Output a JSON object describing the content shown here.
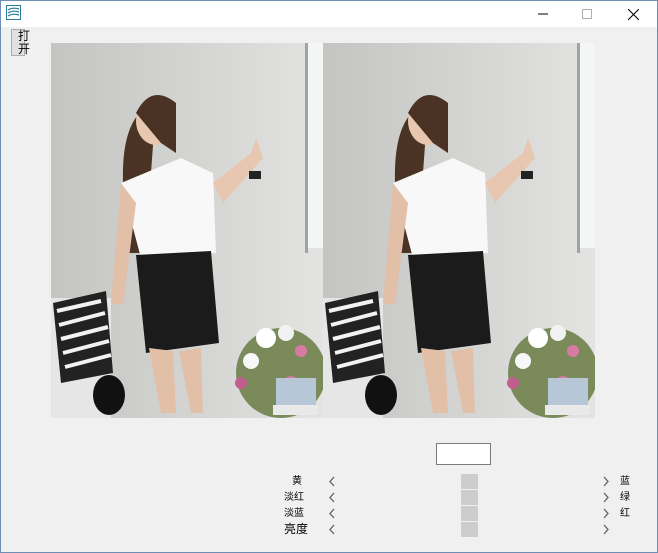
{
  "window": {
    "icon": "app-icon",
    "controls": [
      "minimize-icon",
      "maximize-icon",
      "close-icon"
    ]
  },
  "toolbar": {
    "open_label": "打开"
  },
  "images": [
    {
      "name": "photo-original",
      "icon": "photo-image"
    },
    {
      "name": "photo-adjusted",
      "icon": "photo-image"
    }
  ],
  "value_box": {
    "value": ""
  },
  "sliders": [
    {
      "left_label": "黄",
      "right_label": "蓝",
      "value": 0.5
    },
    {
      "left_label": "淡红",
      "right_label": "绿",
      "value": 0.5
    },
    {
      "left_label": "淡蓝",
      "right_label": "红",
      "value": 0.5
    },
    {
      "left_label": "亮度",
      "right_label": "",
      "value": 0.5
    }
  ],
  "colors": {
    "accent": "#0078d7",
    "track": "#f0f0f0",
    "thumb": "#cdcdcd"
  }
}
